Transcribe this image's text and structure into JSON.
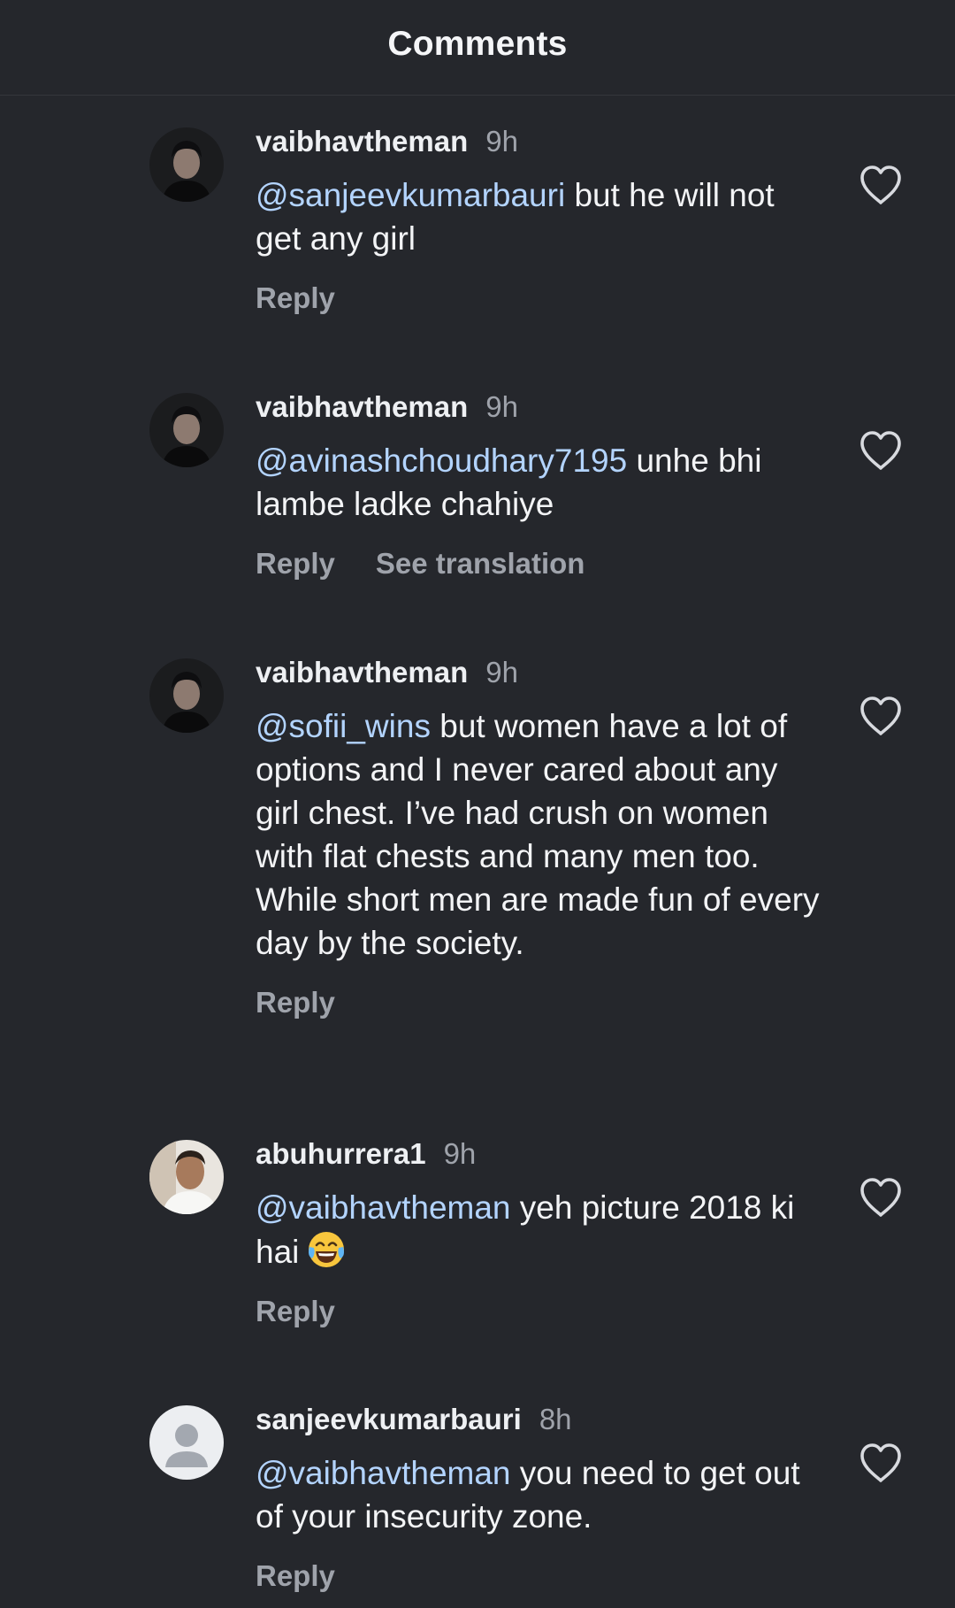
{
  "header": {
    "title": "Comments"
  },
  "comments": [
    {
      "username": "vaibhavtheman",
      "time": "9h",
      "mention": "@sanjeevkumarbauri",
      "text": " but he will not get any girl",
      "reply": "Reply",
      "translate": ""
    },
    {
      "username": "vaibhavtheman",
      "time": "9h",
      "mention": "@avinashchoudhary7195",
      "text": " unhe bhi lambe ladke chahiye",
      "reply": "Reply",
      "translate": "See translation"
    },
    {
      "username": "vaibhavtheman",
      "time": "9h",
      "mention": "@sofii_wins",
      "text": " but women have a lot of options and I never cared about any girl chest. I’ve had crush on women with flat chests and many men too. While short men are made fun of every day by the society.",
      "reply": "Reply",
      "translate": ""
    },
    {
      "username": "abuhurrera1",
      "time": "9h",
      "mention": "@vaibhavtheman",
      "text": " yeh picture 2018 ki hai",
      "reply": "Reply",
      "translate": ""
    },
    {
      "username": "sanjeevkumarbauri",
      "time": "8h",
      "mention": "@vaibhavtheman",
      "text": " you need to get out of your insecurity zone.",
      "reply": "Reply",
      "translate": ""
    }
  ],
  "icons": {
    "like": "heart-outline-icon",
    "emoji": "face-with-tears-of-joy-icon",
    "default_avatar": "default-profile-icon"
  },
  "colors": {
    "background": "#25272c",
    "mention": "#b3d4ff",
    "secondary_text": "#9fa3ab"
  }
}
